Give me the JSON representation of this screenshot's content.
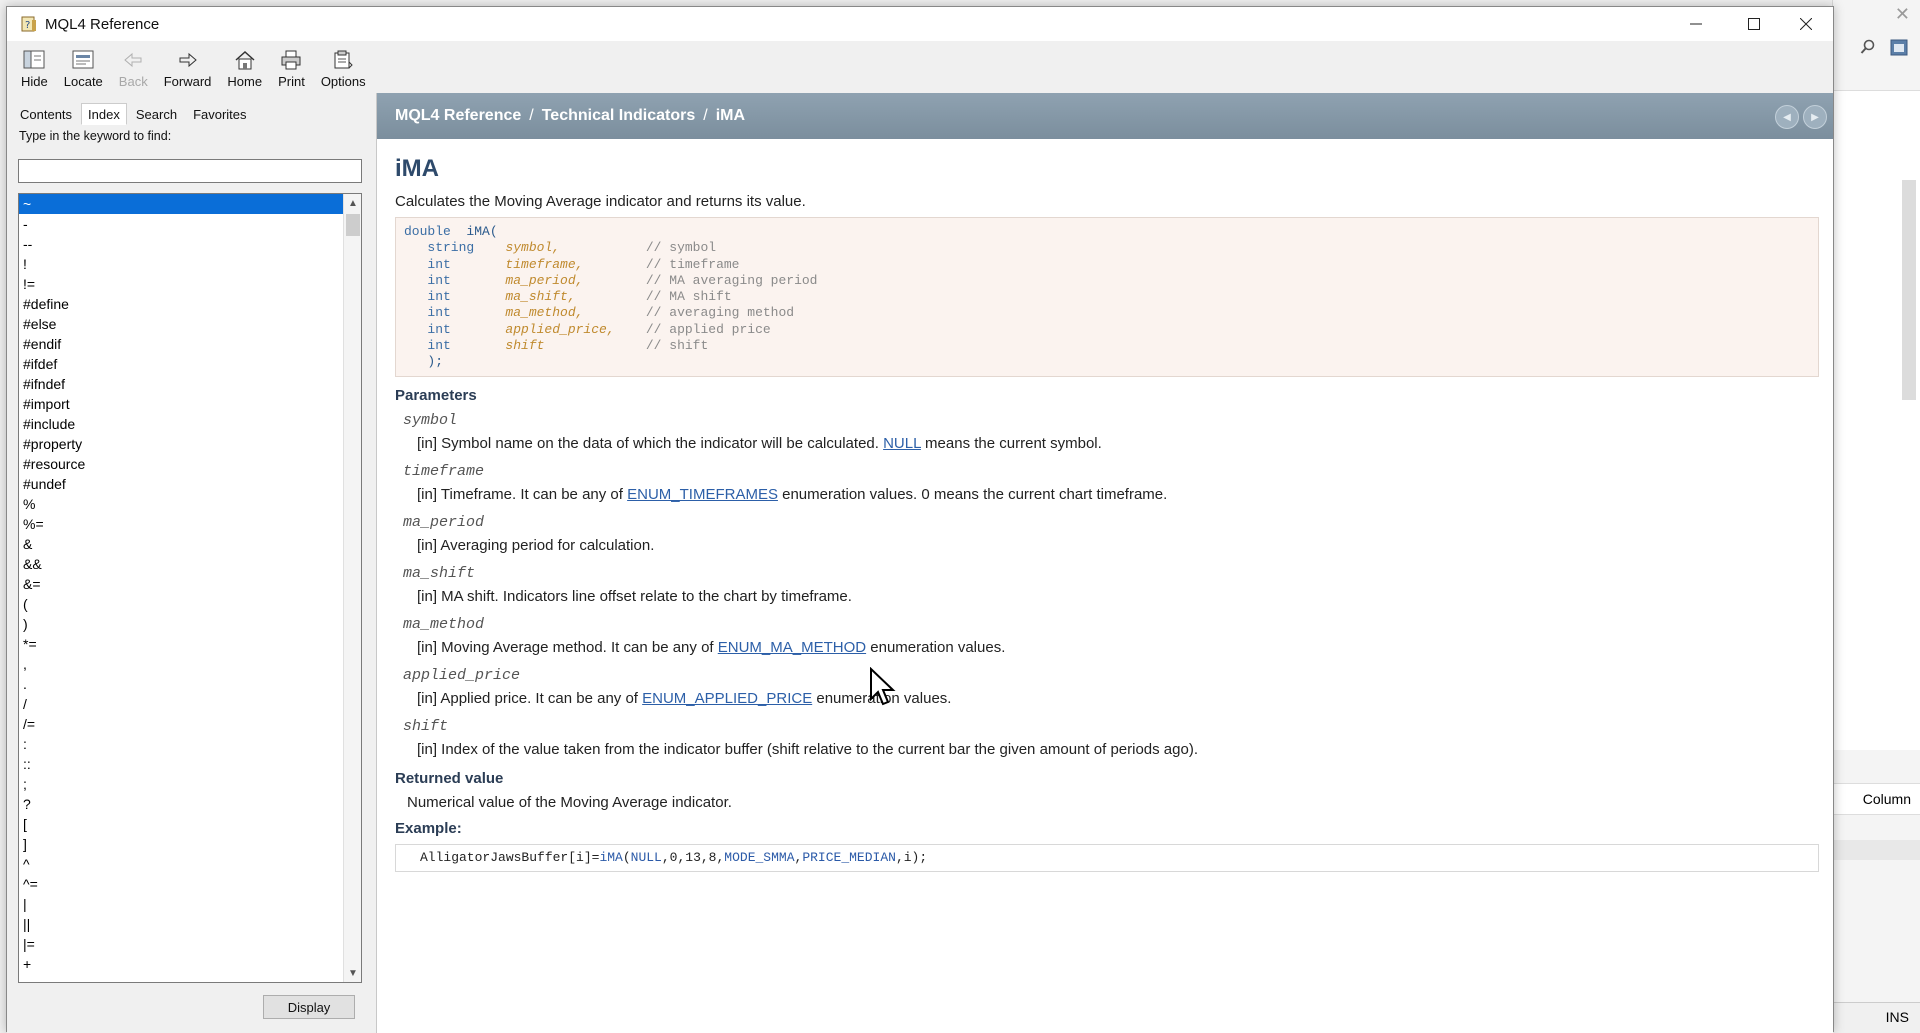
{
  "window": {
    "title": "MQL4 Reference",
    "minimize": "—",
    "maximize": "☐",
    "close": "✕"
  },
  "toolbar": {
    "hide": "Hide",
    "locate": "Locate",
    "back": "Back",
    "forward": "Forward",
    "home": "Home",
    "print": "Print",
    "options": "Options"
  },
  "nav": {
    "tabs": [
      "Contents",
      "Index",
      "Search",
      "Favorites"
    ],
    "keyword_label": "Type in the keyword to find:",
    "keyword_value": "",
    "index_items": [
      "~",
      "-",
      "--",
      "!",
      "!=",
      "#define",
      "#else",
      "#endif",
      "#ifdef",
      "#ifndef",
      "#import",
      "#include",
      "#property",
      "#resource",
      "#undef",
      "%",
      "%=",
      "&",
      "&&",
      "&=",
      "(",
      ")",
      "*=",
      ",",
      ".",
      "/",
      "/=",
      ":",
      "::",
      ";",
      "?",
      "[",
      "]",
      "^",
      "^=",
      "|",
      "||",
      "|=",
      "+"
    ],
    "display_button": "Display"
  },
  "doc": {
    "breadcrumb": [
      "MQL4 Reference",
      "Technical Indicators",
      "iMA"
    ],
    "title": "iMA",
    "description": "Calculates the Moving Average indicator and returns its value.",
    "signature": {
      "return_type": "double",
      "func_name": "iMA(",
      "params": [
        {
          "type": "string",
          "name": "symbol,",
          "comment": "// symbol"
        },
        {
          "type": "int",
          "name": "timeframe,",
          "comment": "// timeframe"
        },
        {
          "type": "int",
          "name": "ma_period,",
          "comment": "// MA averaging period"
        },
        {
          "type": "int",
          "name": "ma_shift,",
          "comment": "// MA shift"
        },
        {
          "type": "int",
          "name": "ma_method,",
          "comment": "// averaging method"
        },
        {
          "type": "int",
          "name": "applied_price,",
          "comment": "// applied price"
        },
        {
          "type": "int",
          "name": "shift",
          "comment": "// shift"
        }
      ],
      "close": ");"
    },
    "parameters_title": "Parameters",
    "parameters": [
      {
        "name": "symbol",
        "pre": "[in]  Symbol name on the data of which the indicator will be calculated. ",
        "link": "NULL",
        "post": " means the current symbol."
      },
      {
        "name": "timeframe",
        "pre": "[in]  Timeframe. It can be any of ",
        "link": "ENUM_TIMEFRAMES",
        "post": " enumeration values. 0 means the current chart timeframe."
      },
      {
        "name": "ma_period",
        "pre": "[in]  Averaging period for calculation.",
        "link": "",
        "post": ""
      },
      {
        "name": "ma_shift",
        "pre": "[in]  MA shift. Indicators line offset relate to the chart by timeframe.",
        "link": "",
        "post": ""
      },
      {
        "name": "ma_method",
        "pre": "[in]  Moving Average method. It can be any of ",
        "link": "ENUM_MA_METHOD",
        "post": " enumeration values."
      },
      {
        "name": "applied_price",
        "pre": "[in]  Applied price. It can be any of ",
        "link": "ENUM_APPLIED_PRICE",
        "post": " enumeration values."
      },
      {
        "name": "shift",
        "pre": "[in]  Index of the value taken from the indicator buffer (shift relative to the current bar the given amount of periods ago).",
        "link": "",
        "post": ""
      }
    ],
    "returned_title": "Returned value",
    "returned_text": "Numerical value of the Moving Average indicator.",
    "example_title": "Example:",
    "example": {
      "lhs": "AlligatorJawsBuffer[i]=",
      "func": "iMA",
      "args_open": "(",
      "a1": "NULL",
      "a2": ",0,13,8,",
      "a3": "MODE_SMMA",
      "a4": ",",
      "a5": "PRICE_MEDIAN",
      "a6": ",i);"
    }
  },
  "background_app": {
    "column_label": "Column",
    "status": "INS"
  },
  "colors": {
    "header_bg": "#8597a6",
    "selection": "#0a6ed8",
    "link": "#2c5fa8",
    "code_bg": "#fbf3ef"
  }
}
